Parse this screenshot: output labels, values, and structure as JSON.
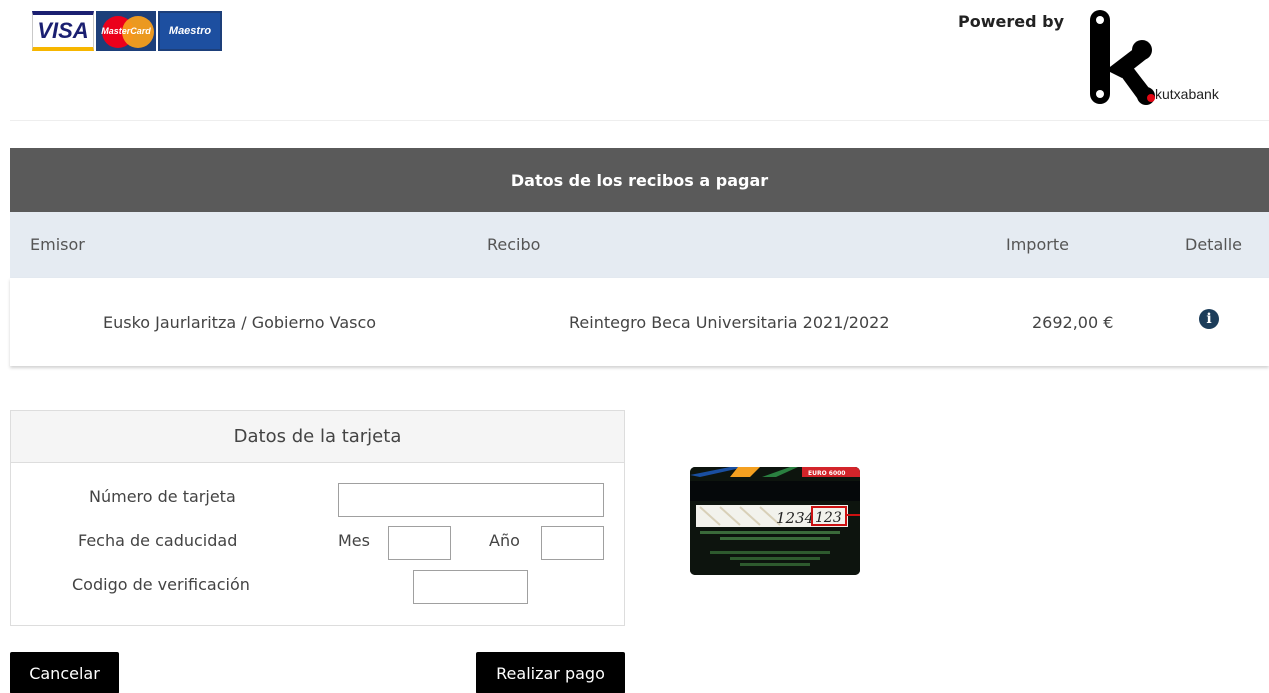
{
  "header": {
    "card_logos": [
      {
        "name": "VISA",
        "icon": "visa-logo"
      },
      {
        "name": "MasterCard",
        "icon": "mastercard-logo"
      },
      {
        "name": "Maestro",
        "icon": "maestro-logo"
      }
    ],
    "powered_by": "Powered by",
    "bank_name": "kutxabank"
  },
  "receipts": {
    "title": "Datos de los recibos a pagar",
    "columns": {
      "emisor": "Emisor",
      "recibo": "Recibo",
      "importe": "Importe",
      "detalle": "Detalle"
    },
    "rows": [
      {
        "emisor": "Eusko Jaurlaritza / Gobierno Vasco",
        "recibo": "Reintegro Beca Universitaria 2021/2022",
        "importe": "2692,00 €",
        "detalle_icon": "info-icon"
      }
    ]
  },
  "card_form": {
    "title": "Datos de la tarjeta",
    "card_number_label": "Número de tarjeta",
    "card_number_value": "",
    "expiry_label": "Fecha de caducidad",
    "month_label": "Mes",
    "month_value": "",
    "year_label": "Año",
    "year_value": "",
    "cvv_label": "Codigo de verificación",
    "cvv_value": ""
  },
  "cvv_illustration": {
    "brand_text": "EURO 6000",
    "card_number_hint": "1234",
    "cvv_hint": "123",
    "highlight_color": "#cc1111"
  },
  "actions": {
    "cancel_label": "Cancelar",
    "pay_label": "Realizar pago"
  },
  "colors": {
    "header_bar": "#5a5a5a",
    "column_bar": "#e5ebf2",
    "button": "#000000",
    "info_icon": "#1c3d5a"
  }
}
